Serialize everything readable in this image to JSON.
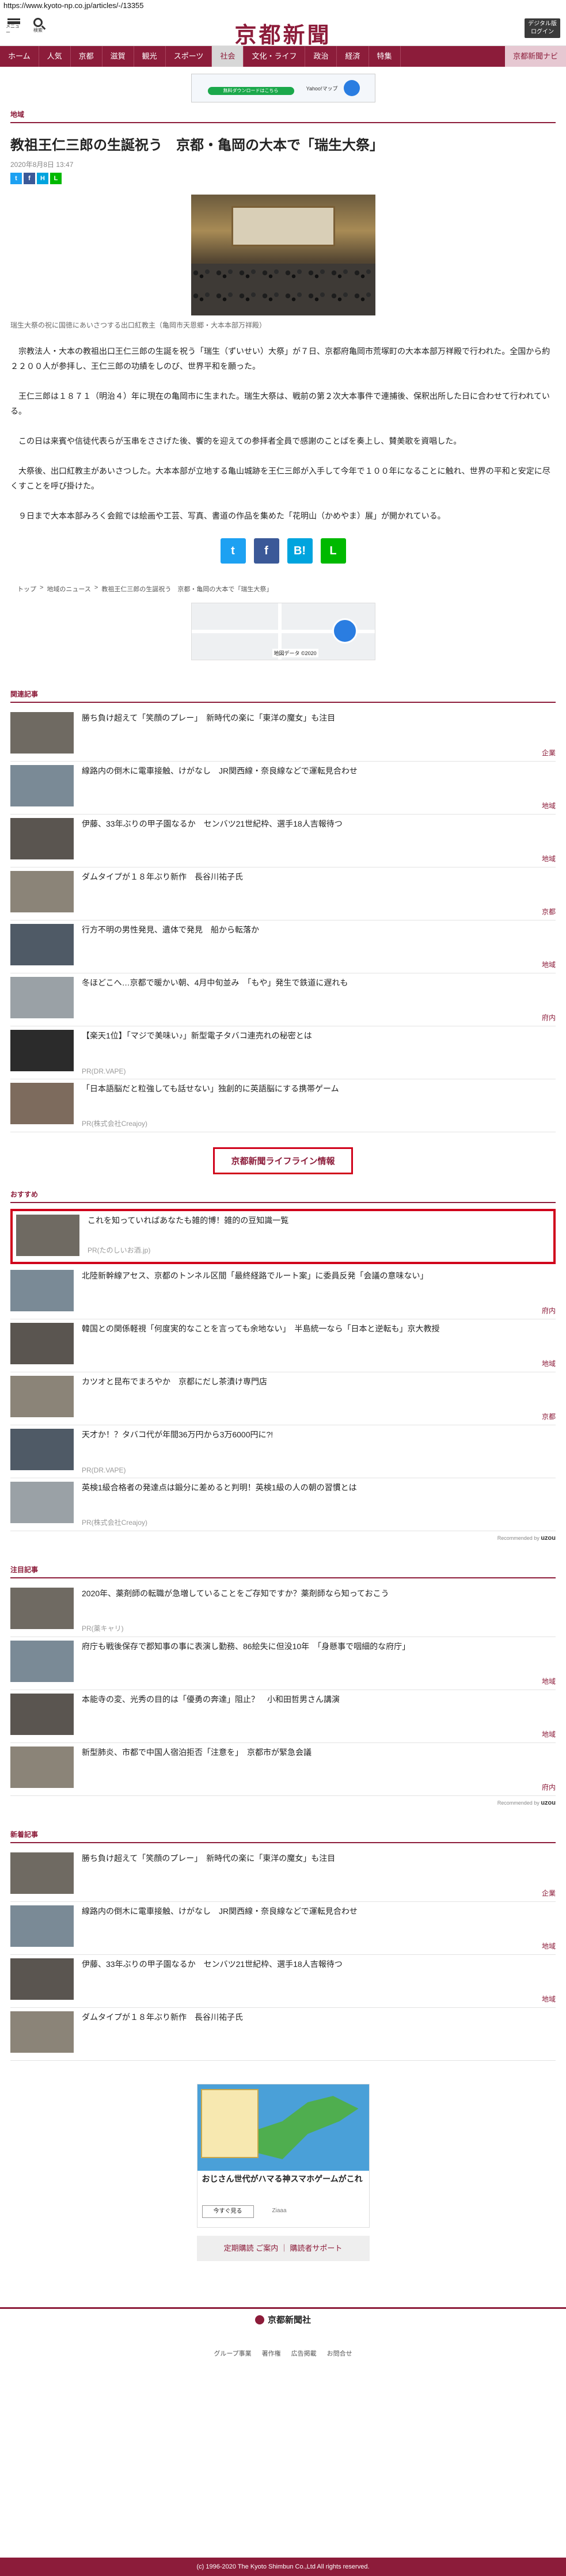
{
  "url": "https://www.kyoto-np.co.jp/articles/-/13355",
  "header": {
    "menu_label": "メニュー",
    "search_label": "検索",
    "logo": "京都新聞",
    "login_label": "デジタル版\nログイン"
  },
  "nav": [
    "ホーム",
    "人気",
    "京都",
    "滋賀",
    "観光",
    "スポーツ",
    "社会",
    "文化・ライフ",
    "政治",
    "経済",
    "特集",
    "京都新聞ナビ"
  ],
  "ad_top": {
    "button": "無料ダウンロードはこちら",
    "brand": "Yahoo!マップ"
  },
  "article": {
    "section": "地域",
    "title": "教祖王仁三郎の生誕祝う　京都・亀岡の大本で「瑞生大祭」",
    "date": "2020年8月8日 13:47",
    "share_mini": [
      "t",
      "f",
      "H",
      "L"
    ],
    "caption": "瑞生大祭の祝に国徳にあいさつする出口紅教主（亀岡市天恩郷・大本本部万祥殿）",
    "paragraphs": [
      "　宗教法人・大本の教祖出口王仁三郎の生誕を祝う「瑞生（ずいせい）大祭」が７日、京都府亀岡市荒塚町の大本本部万祥殿で行われた。全国から約２２００人が参拝し、王仁三郎の功績をしのび、世界平和を願った。",
      "　王仁三郎は１８７１（明治４）年に現在の亀岡市に生まれた。瑞生大祭は、戦前の第２次大本事件で連捕後、保釈出所した日に合わせて行われている。",
      "　この日は来賓や信徒代表らが玉串をささげた後、饗的を迎えての参拝者全員で感謝のことばを奏上し、賛美歌を資唱した。",
      "　大祭後、出口紅教主があいさつした。大本本部が立地する亀山城跡を王仁三郎が入手して今年で１００年になることに触れ、世界の平和と安定に尽くすことを呼び掛けた。",
      "　９日まで大本本部みろく会館では絵画や工芸、写真、書道の作品を集めた「花明山（かめやま）展」が開かれている。"
    ],
    "share_big": [
      "t",
      "f",
      "B!",
      "L"
    ],
    "breadcrumb": [
      "トップ",
      "地域のニュース",
      "教祖王仁三郎の生誕祝う　京都・亀岡の大本で「瑞生大祭」"
    ]
  },
  "map_ad_label": "地図データ ©2020",
  "related": {
    "heading": "関連記事",
    "items": [
      {
        "title": "勝ち負け超えて「笑顔のプレー」　新時代の楽に「東洋の魔女」も注目",
        "cat": "企業"
      },
      {
        "title": "線路内の倒木に電車接触、けがなし　JR関西線・奈良線などで運転見合わせ",
        "cat": "地域"
      },
      {
        "title": "伊藤、33年ぶりの甲子園なるか　センバツ21世紀枠、選手18人吉報待つ",
        "cat": "地域"
      },
      {
        "title": "ダムタイプが１８年ぶり新作　長谷川祐子氏",
        "cat": "京都"
      },
      {
        "title": "行方不明の男性発見、遺体で発見　船から転落か",
        "cat": "地域"
      },
      {
        "title": "冬ほどこへ…京都で暖かい朝、4月中旬並み　「もや」発生で鉄道に遅れも",
        "cat": "府内"
      },
      {
        "title": "【楽天1位】「マジで美味い♪」新型電子タバコ連売れの秘密とは",
        "pr": "PR(DR.VAPE)"
      },
      {
        "title": "「日本語脳だと粒強しても話せない」独創的に英語脳にする携帯ゲーム",
        "pr": "PR(株式会社Creajoy)"
      }
    ]
  },
  "lifeline": "京都新聞ライフライン情報",
  "recommend": {
    "heading": "おすすめ",
    "items": [
      {
        "title": "これを知っていればあなたも雑的博！雑的の豆知識一覧",
        "pr": "PR(たのしいお酒.jp)"
      },
      {
        "title": "北陸新幹線アセス、京都のトンネル区間「最終経路でルート案」に委員反発「会議の意味ない」",
        "cat": "府内"
      },
      {
        "title": "韓国との関係軽視「何度実的なことを言っても余地ない」　半島統一なら「日本と逆転も」京大教授",
        "cat": "地域"
      },
      {
        "title": "カツオと昆布でまろやか　京都にだし茶漬け専門店",
        "cat": "京都"
      },
      {
        "title": "天才か！？タバコ代が年間36万円から3万6000円に?!",
        "pr": "PR(DR.VAPE)"
      },
      {
        "title": "英検1級合格者の発達点は鍛分に差めると判明！英検1級の人の朝の習慣とは",
        "pr": "PR(株式会社Creajoy)"
      }
    ],
    "recommended_by": "Recommended by",
    "brand": "uzou"
  },
  "attention": {
    "heading": "注目記事",
    "items": [
      {
        "title": "2020年、薬剤師の転職が急増していることをご存知ですか？薬剤師なら知っておこう",
        "pr": "PR(薬キャリ)"
      },
      {
        "title": "府庁も戦後保存で郡知事の事に表演し勤務、86絵失に但没10年　「身懸事で咽細的な府庁」",
        "cat": "地域"
      },
      {
        "title": "本能寺の変、光秀の目的は「優勇の奔達」阻止？　小和田哲男さん講演",
        "cat": "地域"
      },
      {
        "title": "新型肺炎、市都で中国人宿泊拒否「注意を」　京都市が緊急会議",
        "cat": "府内"
      }
    ],
    "recommended_by": "Recommended by",
    "brand": "uzou"
  },
  "latest": {
    "heading": "新着記事",
    "items": [
      {
        "title": "勝ち負け超えて「笑顔のプレー」　新時代の楽に「東洋の魔女」も注目",
        "cat": "企業"
      },
      {
        "title": "線路内の倒木に電車接触、けがなし　JR関西線・奈良線などで運転見合わせ",
        "cat": "地域"
      },
      {
        "title": "伊藤、33年ぶりの甲子園なるか　センバツ21世紀枠、選手18人吉報待つ",
        "cat": "地域"
      },
      {
        "title": "ダムタイプが１８年ぶり新作　長谷川祐子氏",
        "cat": ""
      }
    ]
  },
  "ad_bottom": {
    "title": "おじさん世代がハマる神スマホゲームがこれ",
    "button": "今すぐ見る",
    "source": "Ziaaa"
  },
  "support": "定期購読 ご案内 ｜ 購読者サポート",
  "footer": {
    "logo": "京都新聞社",
    "links": [
      "グループ事業",
      "著作権",
      "広告掲載",
      "お問合せ"
    ],
    "copyright": "(c) 1996-2020 The Kyoto Shimbun Co.,Ltd All rights reserved."
  }
}
